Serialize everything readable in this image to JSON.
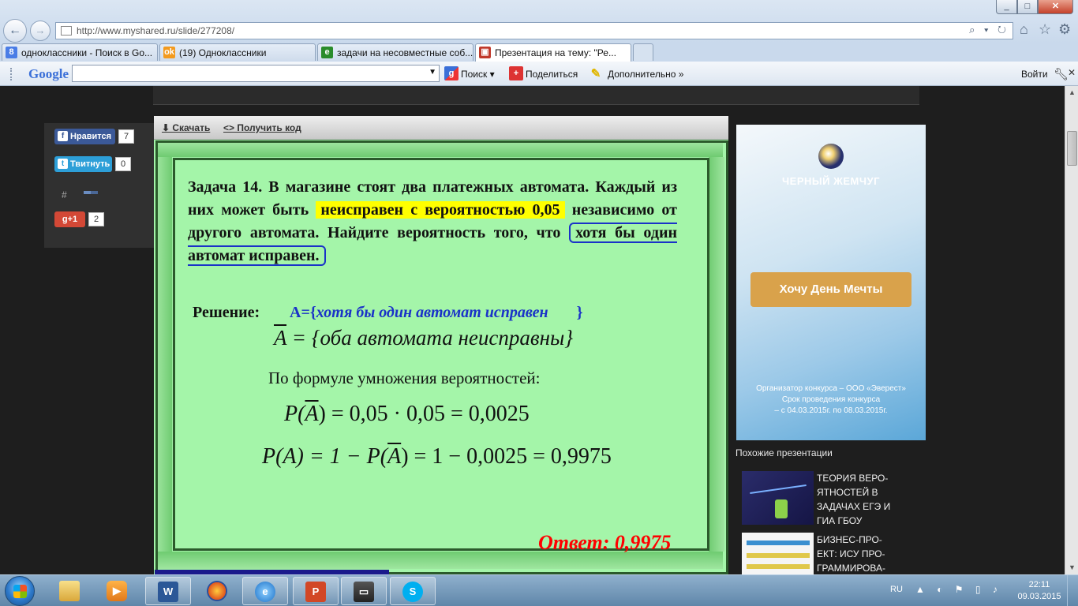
{
  "browser": {
    "url": "http://www.myshared.ru/slide/277208/",
    "addr_tools": "⌕ ▾ ↻",
    "window_buttons": {
      "minimize": "_",
      "maximize": "□",
      "close": "✕"
    },
    "tabs": [
      {
        "label": "одноклассники - Поиск в Go...",
        "icon": "8",
        "icon_color": "#4a7de6"
      },
      {
        "label": "(19) Одноклассники",
        "icon": "ok",
        "icon_color": "#f39a1e"
      },
      {
        "label": "задачи на несовместные соб...",
        "icon": "e",
        "icon_color": "#2a8c2a"
      },
      {
        "label": "Презентация на тему: \"Ре...",
        "icon": "▣",
        "icon_color": "#c0392b",
        "active": true
      }
    ]
  },
  "toolbar": {
    "google_label": "Google",
    "search_label": "Поиск ▾",
    "share_label": "Поделиться",
    "more_label": "Дополнительно »",
    "login_label": "Войти"
  },
  "social": {
    "like_label": "Нравится",
    "like_count": "7",
    "tweet_label": "Твитнуть",
    "tweet_count": "0",
    "hash_label": "#",
    "gplus_label": "g+1",
    "gplus_count": "2"
  },
  "slide_tools": {
    "download_label": "⬇ Скачать",
    "embed_label": "<> Получить код"
  },
  "slide": {
    "problem_1": "Задача  14. В магазине  стоят  два  платежных  автомата. Каждый  из  них  может  быть ",
    "problem_hl": "неисправен  с вероятностью  0,05",
    "problem_2": "  независимо   от   другого   автомата.   Найдите вероятность  того, что ",
    "problem_boxed": "хотя  бы  один  автомат  исправен.",
    "solution_label": "Решение:",
    "event_a_prefix": "A={",
    "event_a_text": "хотя бы один автомат исправен",
    "event_a_suffix": "}",
    "event_not_a": "A",
    "event_not_a_rest": " = {оба автомата неисправны}",
    "formula_label": "По формуле умножения вероятностей:",
    "formula_1_lhs": "P(",
    "formula_1_var": "A",
    "formula_1_rhs": ") = 0,05 · 0,05 = 0,0025",
    "formula_2_a": "P(A) = 1 − P(",
    "formula_2_var": "A",
    "formula_2_b": ") = 1 − 0,0025 = 0,9975",
    "answer": "Ответ: 0,9975"
  },
  "ad": {
    "brand": "ЧЕРНЫЙ ЖЕМЧУГ",
    "cta": "Хочу День Мечты",
    "note_1": "Организатор конкурса – ООО «Эверест»",
    "note_2": "Срок проведения конкурса",
    "note_3": "– с 04.03.2015г. по 08.03.2015г."
  },
  "similar": {
    "heading": "Похожие презентации",
    "items": [
      {
        "title": "ТЕОРИЯ ВЕРО-ЯТНОСТЕЙ В ЗАДАЧАХ ЕГЭ И ГИА ГБОУ"
      },
      {
        "title": "БИЗНЕС-ПРО-ЕКТ: ИСУ ПРО-ГРАММИРОВА-"
      }
    ]
  },
  "taskbar": {
    "apps": [
      "explorer-icon",
      "media-player-icon",
      "word-icon",
      "firefox-icon",
      "internet-explorer-icon",
      "powerpoint-icon",
      "video-icon",
      "skype-icon"
    ],
    "word_glyph": "W",
    "ie_glyph": "e",
    "ppt_glyph": "P",
    "skype_glyph": "S",
    "lang": "RU",
    "tray": "▲ ◐ ⚑ ▯ ♪",
    "time": "22:11",
    "date": "09.03.2015"
  }
}
